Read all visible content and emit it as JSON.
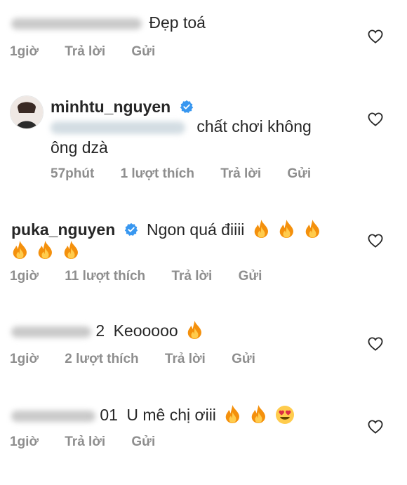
{
  "comments": [
    {
      "username": "",
      "text": "Đẹp toá",
      "time": "1giờ",
      "likes": "",
      "reply_label": "Trả lời",
      "send_label": "Gửi"
    },
    {
      "username": "minhtu_nguyen",
      "verified": true,
      "text_line1": "chất chơi không",
      "text_line2": "ông dzà",
      "time": "57phút",
      "likes": "1 lượt thích",
      "reply_label": "Trả lời",
      "send_label": "Gửi"
    },
    {
      "username": "puka_nguyen",
      "verified": true,
      "text": "Ngon quá điiii",
      "time": "1giờ",
      "likes": "11 lượt thích",
      "reply_label": "Trả lời",
      "send_label": "Gửi"
    },
    {
      "username_visible_suffix": "2",
      "text": "Keooooo",
      "time": "1giờ",
      "likes": "2 lượt thích",
      "reply_label": "Trả lời",
      "send_label": "Gửi"
    },
    {
      "username_visible_suffix": "01",
      "text": "U mê chị ơiii",
      "time": "1giờ",
      "reply_label": "Trả lời",
      "send_label": "Gửi"
    }
  ],
  "icons": {
    "like": "heart-outline-icon",
    "verified": "verified-badge-icon",
    "fire": "fire-emoji",
    "heart_eyes": "heart-eyes-emoji"
  },
  "colors": {
    "text": "#262626",
    "meta": "#8e8e8e",
    "verified": "#3897f0"
  }
}
